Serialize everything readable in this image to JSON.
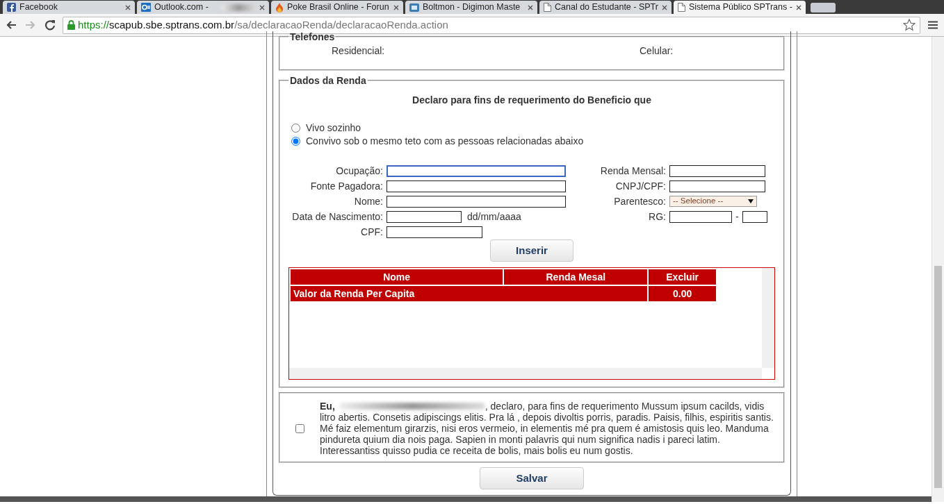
{
  "browser": {
    "tabs": [
      {
        "label": "Facebook",
        "kind": "facebook",
        "selected": false
      },
      {
        "label": "Outlook.com - ",
        "kind": "outlook",
        "selected": false
      },
      {
        "label": "Poke Brasil Online - Forun",
        "kind": "flame",
        "selected": false
      },
      {
        "label": "Boltmon - Digimon Maste",
        "kind": "app",
        "selected": false
      },
      {
        "label": "Canal do Estudante - SPTr",
        "kind": "page",
        "selected": false
      },
      {
        "label": "Sistema Público SPTrans - ",
        "kind": "page",
        "selected": true
      }
    ],
    "url": {
      "scheme": "https://",
      "host": "scapub.sbe.sptrans.com.br",
      "path": "/sa/declaracaoRenda/declaracaoRenda.action"
    }
  },
  "telefones": {
    "legend": "Telefones",
    "fields": [
      {
        "label": "Residencial:"
      },
      {
        "label": "Celular:"
      }
    ]
  },
  "renda": {
    "legend": "Dados da Renda",
    "heading": "Declaro para fins de requerimento do Beneficio que",
    "options": [
      {
        "label": "Vivo sozinho",
        "selected": false
      },
      {
        "label": "Convivo sob o mesmo teto com as pessoas relacionadas abaixo",
        "selected": true
      }
    ],
    "fields_left": [
      {
        "label": "Ocupação:",
        "kind": "wide",
        "focused": true
      },
      {
        "label": "Fonte Pagadora:",
        "kind": "wide",
        "focused": false
      },
      {
        "label": "Nome:",
        "kind": "wide",
        "focused": false
      },
      {
        "label": "Data de Nascimento:",
        "kind": "date",
        "hint": "dd/mm/aaaa",
        "focused": false
      },
      {
        "label": "CPF:",
        "kind": "medium",
        "focused": false
      }
    ],
    "fields_right": [
      {
        "label": "Renda Mensal:",
        "kind": "text"
      },
      {
        "label": "CNPJ/CPF:",
        "kind": "text"
      },
      {
        "label": "Parentesco:",
        "kind": "select",
        "value": "-- Selecione --"
      },
      {
        "label": "RG:",
        "kind": "rg",
        "separator": "-"
      }
    ],
    "insert_button": "Inserir",
    "table": {
      "columns": [
        "Nome",
        "Renda Mesal",
        "Excluir"
      ],
      "summary": {
        "label": "Valor da Renda Per Capita",
        "value": "0.00"
      }
    }
  },
  "declaration": {
    "checked": false,
    "lead": "Eu,",
    "first_line": ", declaro, para fins de requerimento Mussum ipsum cacilds, vidis",
    "text": "litro abertis. Consetis adipiscings elitis. Pra lá , depois divoltis porris, paradis. Paisis, filhis, espiritis santis. Mé faiz elementum girarzis, nisi eros vermeio, in elementis mé pra quem é amistosis quis leo. Manduma pindureta quium dia nois paga. Sapien in monti palavris qui num significa nadis i pareci latim. Interessantiss quisso pudia ce receita de bolis, mais bolis eu num gostis."
  },
  "save_button": "Salvar"
}
